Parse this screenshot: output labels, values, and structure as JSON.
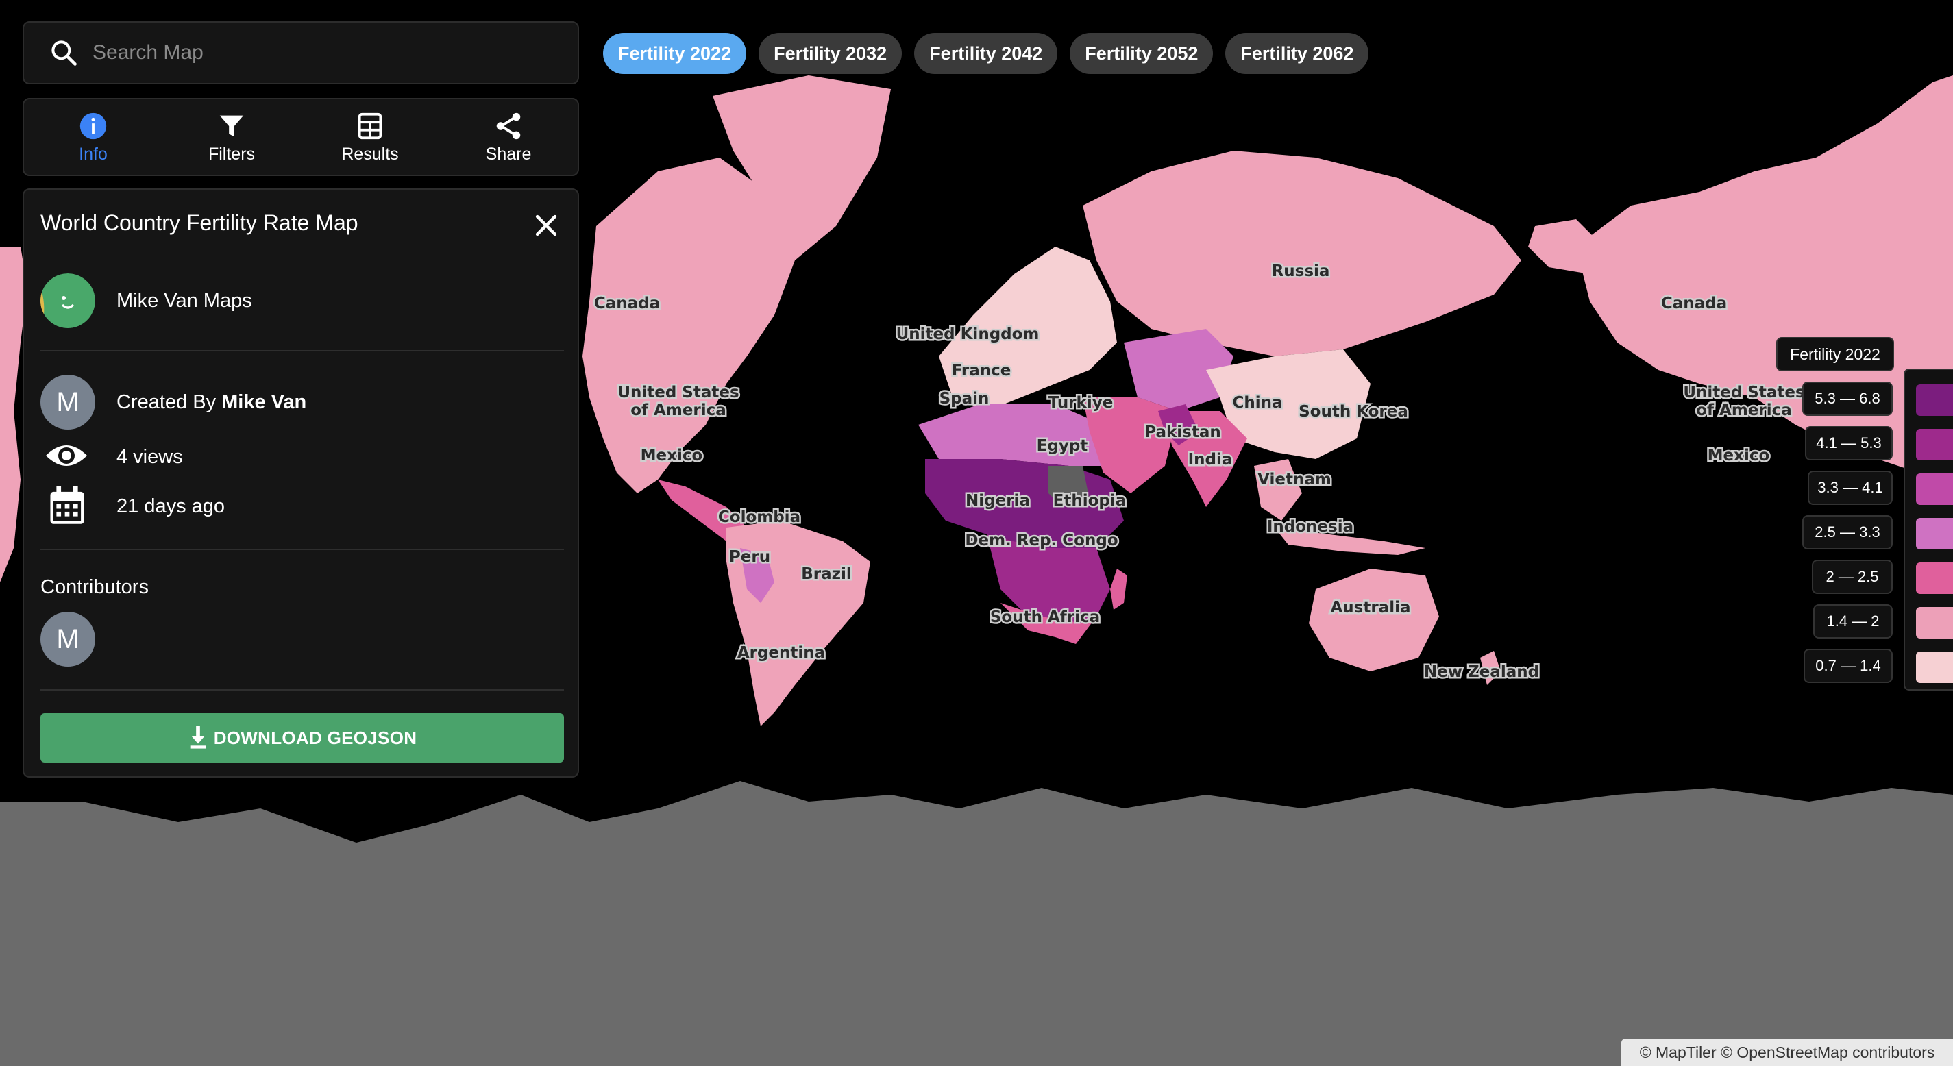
{
  "search": {
    "placeholder": "Search Map",
    "icon": "search-icon"
  },
  "tabs": [
    {
      "label": "Info",
      "icon": "info-icon",
      "active": true
    },
    {
      "label": "Filters",
      "icon": "filter-icon",
      "active": false
    },
    {
      "label": "Results",
      "icon": "results-icon",
      "active": false
    },
    {
      "label": "Share",
      "icon": "share-icon",
      "active": false
    }
  ],
  "panel": {
    "title": "World Country Fertility Rate Map",
    "owner_name": "Mike Van Maps",
    "created_by_prefix": "Created By",
    "created_by_name": "Mike Van",
    "creator_initial": "M",
    "views": "4 views",
    "created_ago": "21 days ago",
    "contributors_label": "Contributors",
    "contributor_initial": "M",
    "download_label": "DOWNLOAD GEOJSON"
  },
  "layers": [
    "Fertility 2022",
    "Fertility 2032",
    "Fertility 2042",
    "Fertility 2052",
    "Fertility 2062"
  ],
  "active_layer": "Fertility 2022",
  "legend": {
    "title": "Fertility 2022",
    "classes": [
      {
        "label": "5.3 — 6.8",
        "color": "#7b1d7e"
      },
      {
        "label": "4.1 — 5.3",
        "color": "#9e2a8c"
      },
      {
        "label": "3.3 — 4.1",
        "color": "#c04aa8"
      },
      {
        "label": "2.5 — 3.3",
        "color": "#cf72c2"
      },
      {
        "label": "2 — 2.5",
        "color": "#e0609c"
      },
      {
        "label": "1.4 — 2",
        "color": "#eda0b8"
      },
      {
        "label": "0.7 — 1.4",
        "color": "#f6d0d3"
      }
    ]
  },
  "map_labels": [
    "Canada",
    "United States of America",
    "Mexico",
    "Colombia",
    "Peru",
    "Brazil",
    "Argentina",
    "United Kingdom",
    "France",
    "Spain",
    "Turkiye",
    "Egypt",
    "Nigeria",
    "Ethiopia",
    "Dem. Rep. Congo",
    "South Africa",
    "Russia",
    "China",
    "South Korea",
    "Pakistan",
    "India",
    "Vietnam",
    "Indonesia",
    "Australia",
    "New Zealand"
  ],
  "repeated_labels": [
    "Canada",
    "United States of America",
    "Mexico"
  ],
  "attribution": "© MapTiler © OpenStreetMap contributors"
}
